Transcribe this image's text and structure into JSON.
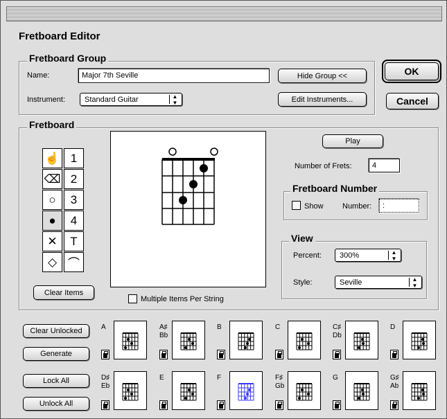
{
  "window": {
    "title": "Fretboard Editor"
  },
  "buttons": {
    "ok": "OK",
    "cancel": "Cancel"
  },
  "group": {
    "heading": "Fretboard Group",
    "name_label": "Name:",
    "name_value": "Major 7th Seville",
    "hide_button": "Hide Group <<",
    "instrument_label": "Instrument:",
    "instrument_value": "Standard Guitar",
    "edit_button": "Edit Instruments..."
  },
  "fretboard": {
    "heading": "Fretboard",
    "palette_numbers": [
      "1",
      "2",
      "3",
      "4",
      "T"
    ],
    "clear_items": "Clear Items",
    "multiple_items_label": "Multiple Items Per String",
    "play": "Play",
    "num_frets_label": "Number of Frets:",
    "num_frets_value": "4",
    "fret_number_heading": "Fretboard Number",
    "show_label": "Show",
    "number_label": "Number:",
    "number_value": ":",
    "view_heading": "View",
    "percent_label": "Percent:",
    "percent_value": "300%",
    "style_label": "Style:",
    "style_value": "Seville"
  },
  "actions": {
    "clear_unlocked": "Clear Unlocked",
    "generate": "Generate",
    "lock_all": "Lock All",
    "unlock_all": "Unlock All"
  },
  "keys_row1": [
    {
      "l1": "A",
      "l2": ""
    },
    {
      "l1": "A♯",
      "l2": "Bb"
    },
    {
      "l1": "B",
      "l2": ""
    },
    {
      "l1": "C",
      "l2": ""
    },
    {
      "l1": "C♯",
      "l2": "Db"
    },
    {
      "l1": "D",
      "l2": ""
    }
  ],
  "keys_row2": [
    {
      "l1": "D♯",
      "l2": "Eb"
    },
    {
      "l1": "E",
      "l2": ""
    },
    {
      "l1": "F",
      "l2": ""
    },
    {
      "l1": "F♯",
      "l2": "Gb"
    },
    {
      "l1": "G",
      "l2": ""
    },
    {
      "l1": "G♯",
      "l2": "Ab"
    }
  ],
  "colors": {
    "selected_thumb": "#3a3aff"
  }
}
